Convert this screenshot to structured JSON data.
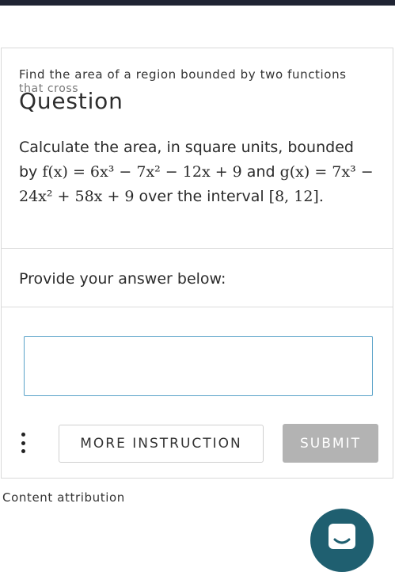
{
  "topic": {
    "line1": "Find the area of a region bounded by two functions",
    "line2": "that cross"
  },
  "heading": "Question",
  "question": {
    "text_before": "Calculate the area, in square units, bounded by",
    "f_expr": "f(x) = 6x³ − 7x² − 12x + 9",
    "text_and": "and",
    "g_expr": "g(x) = 7x³ − 24x² + 58x + 9",
    "text_over": "over the interval",
    "interval": "[8, 12]."
  },
  "answer": {
    "prompt": "Provide your answer below:",
    "value": "",
    "placeholder": ""
  },
  "buttons": {
    "more_instruction": "MORE INSTRUCTION",
    "submit": "SUBMIT"
  },
  "footer": {
    "attribution": "Content attribution"
  },
  "icons": {
    "more_options": "kebab-vertical-icon",
    "chat": "chat-icon"
  },
  "colors": {
    "topbar": "#1f2433",
    "input_border": "#5aa3c9",
    "submit_bg": "#b3b3b3",
    "chat_bg": "#1f5f70"
  }
}
